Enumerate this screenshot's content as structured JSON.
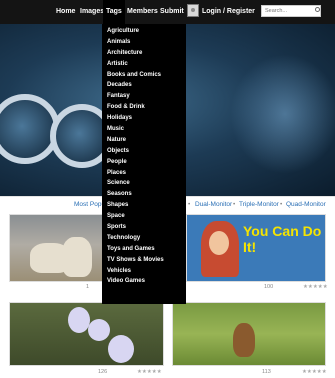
{
  "nav": {
    "items": [
      {
        "label": "Home"
      },
      {
        "label": "Images"
      },
      {
        "label": "Tags"
      },
      {
        "label": "Members"
      },
      {
        "label": "Submit"
      }
    ],
    "login_label": "Login / Register",
    "coin_count": "0",
    "search_placeholder": "Search..."
  },
  "tags_menu": [
    "Agriculture",
    "Animals",
    "Architecture",
    "Artistic",
    "Books and Comics",
    "Decades",
    "Fantasy",
    "Food & Drink",
    "Holidays",
    "Music",
    "Nature",
    "Objects",
    "People",
    "Places",
    "Science",
    "Seasons",
    "Shapes",
    "Space",
    "Sports",
    "Technology",
    "Toys and Games",
    "TV Shows & Movies",
    "Vehicles",
    "Video Games"
  ],
  "resolution_bar": {
    "most_popular": "Most Popu",
    "dual": "Dual-Monitor",
    "triple": "Triple-Monitor",
    "quad": "Quad-Monitor",
    "sep": "•"
  },
  "gallery": [
    {
      "name": "goat",
      "downloads": "1",
      "rating": "★★★★★"
    },
    {
      "name": "you-can-do-it",
      "poster_text": "You Can Do It!",
      "downloads": "100",
      "rating": "★★★★★"
    },
    {
      "name": "flowers",
      "downloads": "126",
      "rating": "★★★★★"
    },
    {
      "name": "marmot",
      "downloads": "113",
      "rating": "★★★★★"
    }
  ]
}
